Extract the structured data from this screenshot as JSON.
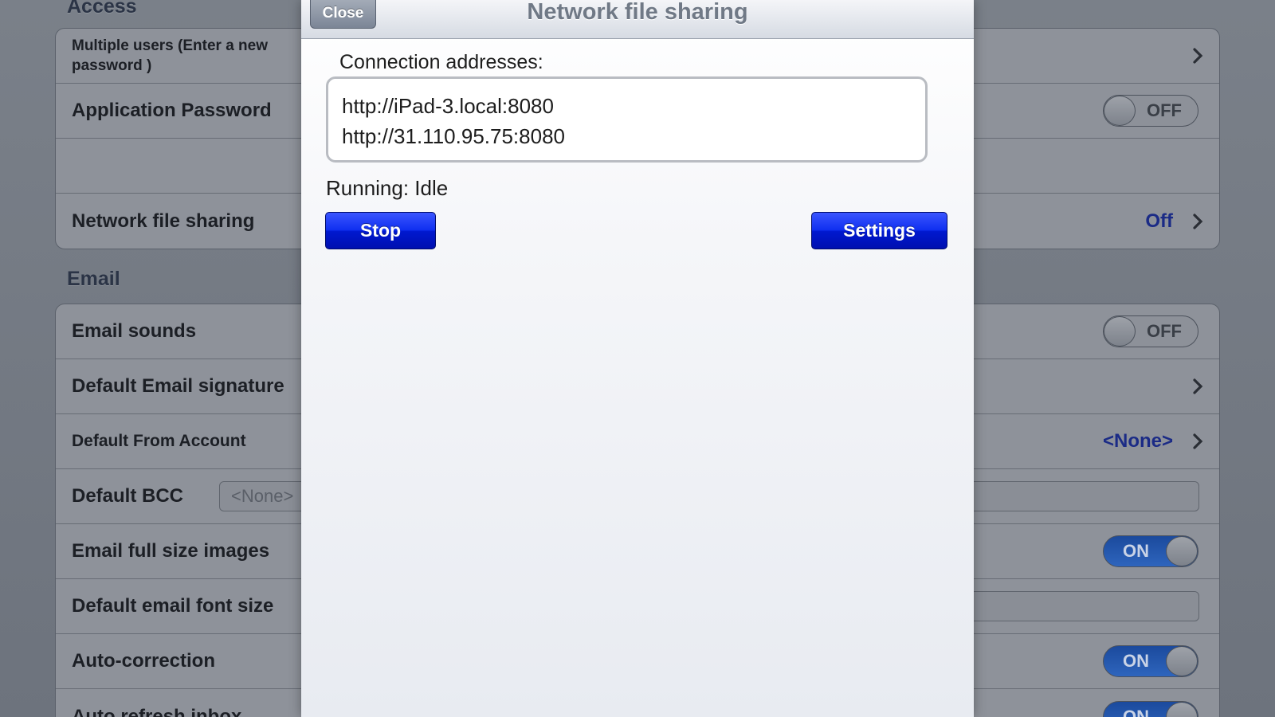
{
  "background": {
    "access_section": {
      "title": "Access",
      "rows": [
        {
          "label": "Multiple users (Enter a new password )"
        },
        {
          "label": "Application Password",
          "switch": "OFF"
        },
        {
          "label": ""
        },
        {
          "label": "Network file sharing",
          "value": "Off"
        }
      ]
    },
    "email_section": {
      "title": "Email",
      "rows": [
        {
          "label": "Email sounds",
          "switch": "OFF"
        },
        {
          "label": "Default Email signature"
        },
        {
          "label": "Default From Account",
          "value": "<None>"
        },
        {
          "label": "Default BCC",
          "placeholder": "<None>"
        },
        {
          "label": "Email full size images",
          "switch": "ON"
        },
        {
          "label": "Default email font size"
        },
        {
          "label": "Auto-correction",
          "switch": "ON"
        },
        {
          "label": "Auto refresh inbox",
          "switch": "ON"
        }
      ]
    }
  },
  "modal": {
    "title": "Network file sharing",
    "close_label": "Close",
    "connection_label": "Connection addresses:",
    "addresses": [
      "http://iPad-3.local:8080",
      "http://31.110.95.75:8080"
    ],
    "status": "Running: Idle",
    "stop_label": "Stop",
    "settings_label": "Settings"
  },
  "colors": {
    "accent_blue": "#0a22d8",
    "value_text": "#1b2b86",
    "overlay_background": "#6f7580"
  },
  "icons": [
    "chevron-right-icon"
  ]
}
